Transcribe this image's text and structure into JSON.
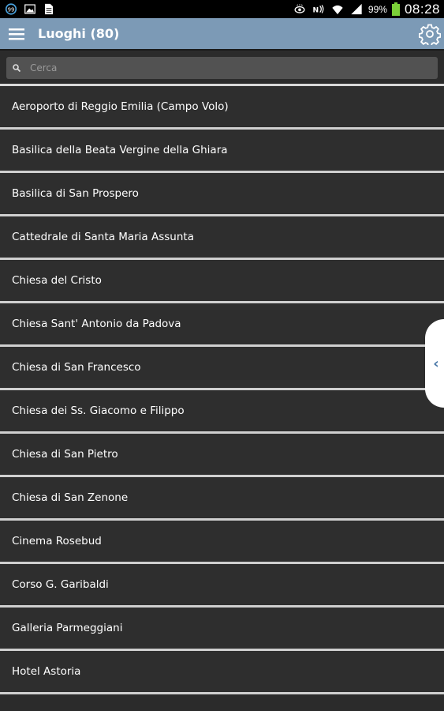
{
  "status_bar": {
    "battery": "99%",
    "time": "08:28",
    "icons": [
      "notification-icon",
      "image-icon",
      "document-icon",
      "eye-icon",
      "nfc-icon",
      "wifi-icon",
      "signal-icon",
      "battery-icon"
    ]
  },
  "app_bar": {
    "title": "Luoghi (80)",
    "menu_icon": "menu-icon",
    "settings_icon": "gear-icon"
  },
  "search": {
    "placeholder": "Cerca",
    "value": ""
  },
  "places": [
    "Aeroporto di Reggio Emilia (Campo Volo)",
    "Basilica della Beata Vergine della Ghiara",
    "Basilica di San Prospero",
    "Cattedrale di Santa Maria Assunta",
    "Chiesa del Cristo",
    "Chiesa Sant' Antonio da Padova",
    "Chiesa di San Francesco",
    "Chiesa dei Ss. Giacomo e Filippo",
    "Chiesa di San Pietro",
    "Chiesa di San Zenone",
    "Cinema Rosebud",
    "Corso G. Garibaldi",
    "Galleria Parmeggiani",
    "Hotel Astoria"
  ],
  "side_handle": {
    "glyph": "‹"
  },
  "colors": {
    "app_bar": "#7c9ab6",
    "list_background": "#2e2e2e",
    "divider": "#cfcfcf",
    "accent": "#4a78a8"
  }
}
